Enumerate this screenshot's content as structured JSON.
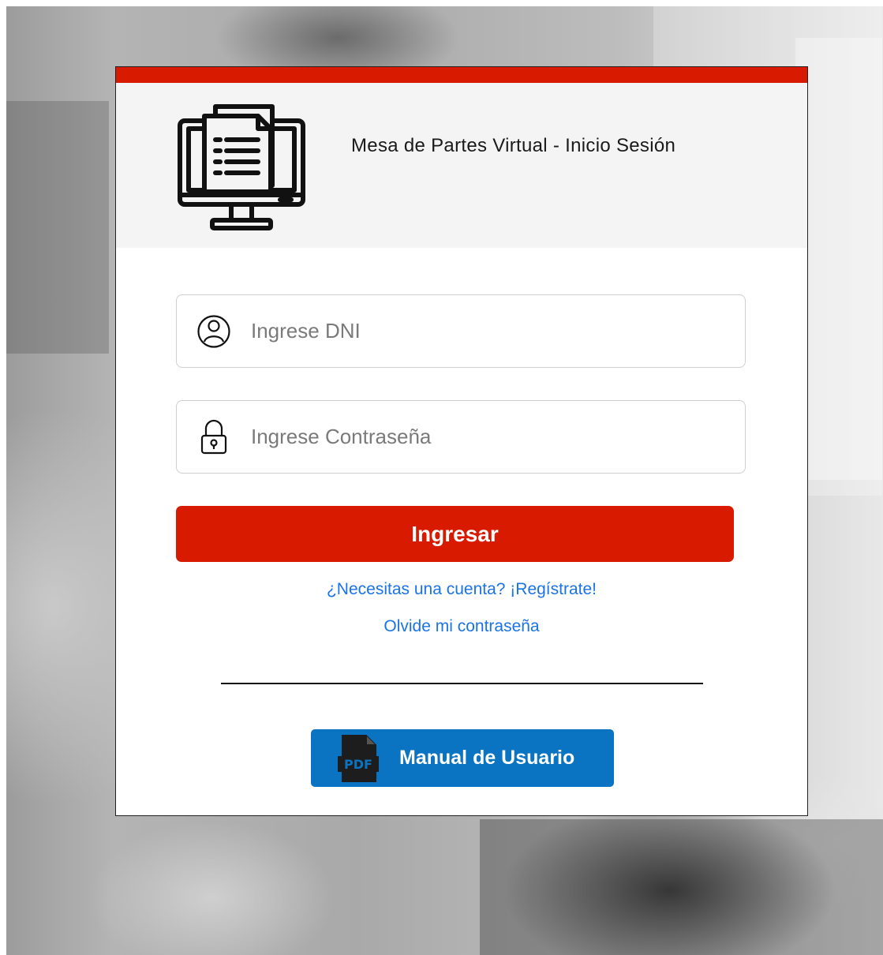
{
  "header": {
    "title": "Mesa de Partes Virtual - Inicio Sesión",
    "logo_icon": "computer-document-icon"
  },
  "form": {
    "dni": {
      "placeholder": "Ingrese DNI",
      "value": "",
      "icon": "user-icon"
    },
    "password": {
      "placeholder": "Ingrese Contraseña",
      "value": "",
      "icon": "lock-icon"
    },
    "submit_label": "Ingresar"
  },
  "links": {
    "register": "¿Necesitas una cuenta? ¡Regístrate!",
    "forgot": "Olvide mi contraseña"
  },
  "manual": {
    "label": "Manual de Usuario",
    "icon": "pdf-icon"
  },
  "colors": {
    "accent": "#d81b00",
    "link": "#1a73e8",
    "manual_button": "#0a74c2",
    "header_bg": "#f4f4f4"
  }
}
